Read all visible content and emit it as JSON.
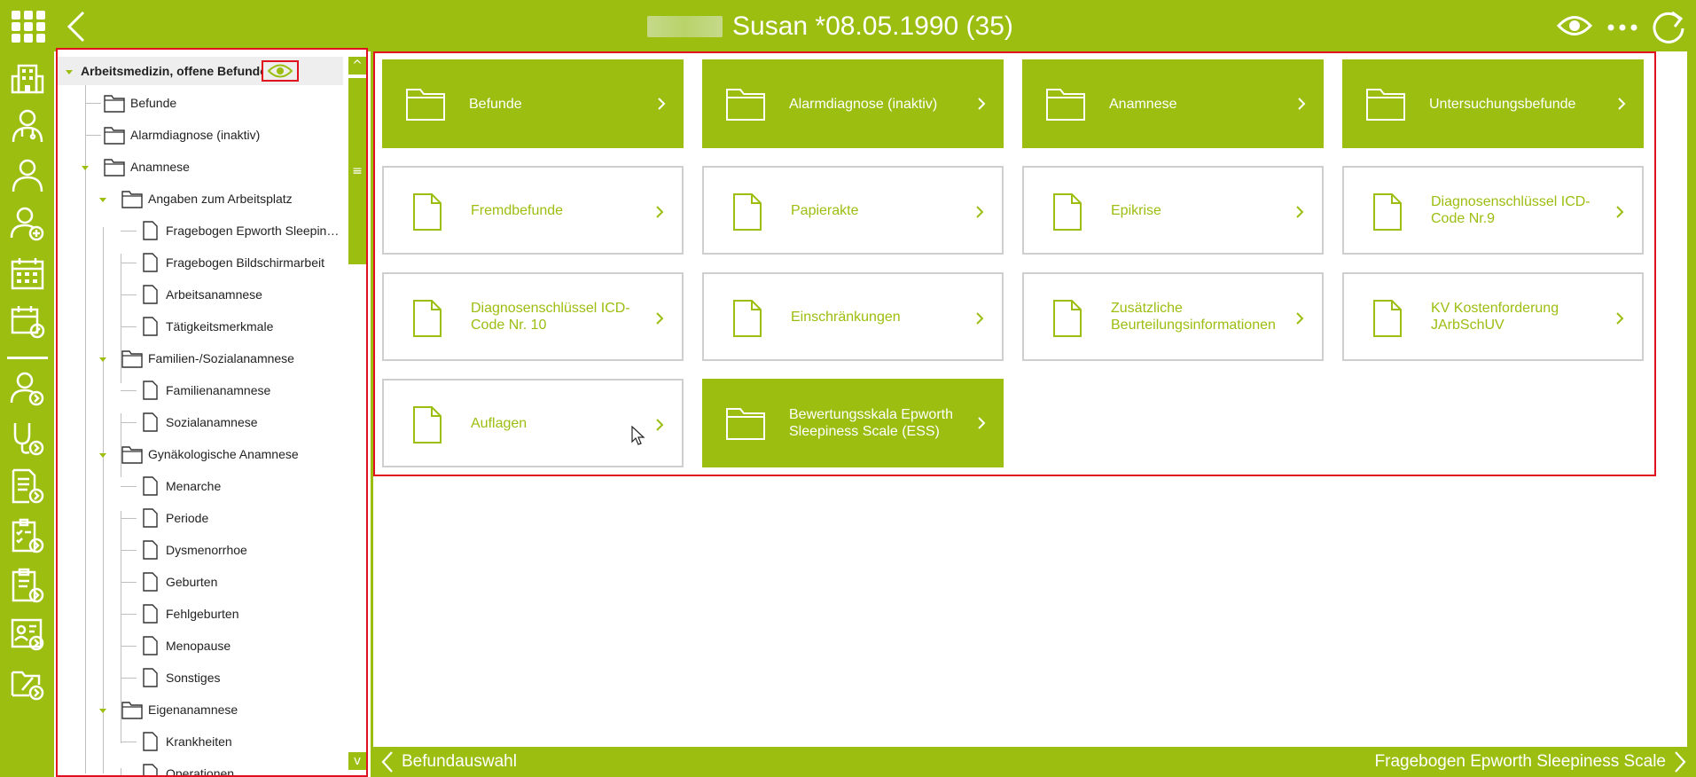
{
  "header": {
    "title": "Susan *08.05.1990 (35)"
  },
  "tree": {
    "root_label": "Arbeitsmedizin, offene Befunde",
    "items": [
      {
        "label": "Befunde",
        "type": "folder"
      },
      {
        "label": "Alarmdiagnose (inaktiv)",
        "type": "folder"
      },
      {
        "label": "Anamnese",
        "type": "folder"
      },
      {
        "label": "Angaben zum Arbeitsplatz",
        "type": "folder"
      },
      {
        "label": "Fragebogen Epworth Sleepine...",
        "type": "file"
      },
      {
        "label": "Fragebogen Bildschirmarbeit",
        "type": "file"
      },
      {
        "label": "Arbeitsanamnese",
        "type": "file"
      },
      {
        "label": "Tätigkeitsmerkmale",
        "type": "file"
      },
      {
        "label": "Familien-/Sozialanamnese",
        "type": "folder"
      },
      {
        "label": "Familienanamnese",
        "type": "file"
      },
      {
        "label": "Sozialanamnese",
        "type": "file"
      },
      {
        "label": "Gynäkologische Anamnese",
        "type": "folder"
      },
      {
        "label": "Menarche",
        "type": "file"
      },
      {
        "label": "Periode",
        "type": "file"
      },
      {
        "label": "Dysmenorrhoe",
        "type": "file"
      },
      {
        "label": "Geburten",
        "type": "file"
      },
      {
        "label": "Fehlgeburten",
        "type": "file"
      },
      {
        "label": "Menopause",
        "type": "file"
      },
      {
        "label": "Sonstiges",
        "type": "file"
      },
      {
        "label": "Eigenanamnese",
        "type": "folder"
      },
      {
        "label": "Krankheiten",
        "type": "file"
      },
      {
        "label": "Operationen",
        "type": "file"
      }
    ]
  },
  "scrollbar": {
    "up": "^",
    "thumb": "≡",
    "down": "v"
  },
  "tiles": [
    {
      "label": "Befunde",
      "type": "folder"
    },
    {
      "label": "Alarmdiagnose (inaktiv)",
      "type": "folder"
    },
    {
      "label": "Anamnese",
      "type": "folder"
    },
    {
      "label": "Untersuchungsbefunde",
      "type": "folder"
    },
    {
      "label": "Fremdbefunde",
      "type": "file"
    },
    {
      "label": "Papierakte",
      "type": "file"
    },
    {
      "label": "Epikrise",
      "type": "file"
    },
    {
      "label": "Diagnosenschlüssel ICD-Code Nr.9",
      "type": "file"
    },
    {
      "label": "Diagnosenschlüssel ICD-Code Nr. 10",
      "type": "file"
    },
    {
      "label": "Einschränkungen",
      "type": "file"
    },
    {
      "label": "Zusätzliche Beurteilungsinformationen",
      "type": "file"
    },
    {
      "label": "KV Kostenforderung JArbSchUV",
      "type": "file"
    },
    {
      "label": "Auflagen",
      "type": "file"
    },
    {
      "label": "Bewertungsskala Epworth Sleepiness Scale (ESS)",
      "type": "folder"
    }
  ],
  "footer": {
    "left_label": "Befundauswahl",
    "right_label": "Fragebogen Epworth Sleepiness Scale"
  },
  "colors": {
    "accent": "#9bbe11",
    "highlight": "#e0101f"
  },
  "icons": [
    "apps-grid-icon",
    "back-icon",
    "eye-icon",
    "more-icon",
    "refresh-icon",
    "building-icon",
    "doctor-icon",
    "person-icon",
    "person-add-icon",
    "calendar-icon",
    "calendar-edit-icon",
    "person-next-icon",
    "stethoscope-icon",
    "document-next-icon",
    "checklist-icon",
    "clipboard-icon",
    "id-card-icon",
    "folder-edit-icon"
  ]
}
